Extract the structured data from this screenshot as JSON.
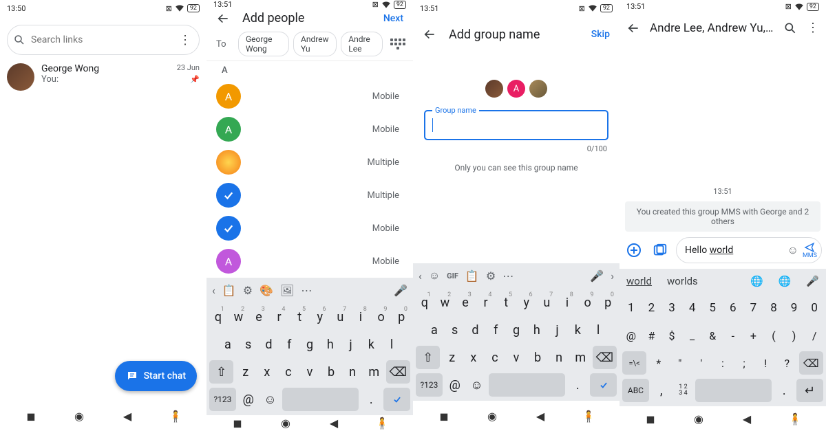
{
  "status": {
    "t1": "13:50",
    "t2": "13:51",
    "batt": "92"
  },
  "s1": {
    "search_ph": "Search links",
    "conv": {
      "name": "George Wong",
      "sub": "You:",
      "date": "23 Jun"
    },
    "fab": "Start chat"
  },
  "s2": {
    "title": "Add people",
    "next": "Next",
    "to": "To",
    "chips": [
      "George Wong",
      "Andrew Yu",
      "Andre Lee"
    ],
    "section": "A",
    "rows": [
      {
        "color": "#f29900",
        "ltr": "A",
        "type": "Mobile"
      },
      {
        "color": "#34a853",
        "ltr": "A",
        "type": "Mobile"
      },
      {
        "img": true,
        "type": "Multiple"
      },
      {
        "check": true,
        "type": "Multiple"
      },
      {
        "check": true,
        "type": "Mobile"
      },
      {
        "color": "#c158dc",
        "ltr": "A",
        "type": "Mobile"
      }
    ]
  },
  "s3": {
    "title": "Add group name",
    "skip": "Skip",
    "label": "Group name",
    "count": "0/100",
    "hint": "Only you can see this group name"
  },
  "s4": {
    "title": "Andre Lee, Andrew Yu, Geor...",
    "ts": "13:51",
    "sys": "You created this group MMS with George and 2 others",
    "msg_pre": "Hello ",
    "msg_ul": "world",
    "mms": "MMS",
    "sugg": [
      "world",
      "worlds"
    ]
  },
  "kb": {
    "r1": [
      "q",
      "w",
      "e",
      "r",
      "t",
      "y",
      "u",
      "i",
      "o",
      "p"
    ],
    "r1n": [
      "1",
      "2",
      "3",
      "4",
      "5",
      "6",
      "7",
      "8",
      "9",
      "0"
    ],
    "r2": [
      "a",
      "s",
      "d",
      "f",
      "g",
      "h",
      "j",
      "k",
      "l"
    ],
    "r3": [
      "z",
      "x",
      "c",
      "v",
      "b",
      "n",
      "m"
    ],
    "sym": "?123",
    "at": "@",
    "dot": ".",
    "nums": [
      "1",
      "2",
      "3",
      "4",
      "5",
      "6",
      "7",
      "8",
      "9",
      "0"
    ],
    "syms1": [
      "@",
      "#",
      "$",
      "_",
      "&",
      "-",
      "+",
      "(",
      ")",
      "/"
    ],
    "syms2": [
      "=\\<",
      "*",
      "\"",
      "'",
      ":",
      ";",
      "!",
      "?"
    ],
    "abc": "ABC",
    "comma": ",",
    "n1234": "1 2\n3 4"
  }
}
